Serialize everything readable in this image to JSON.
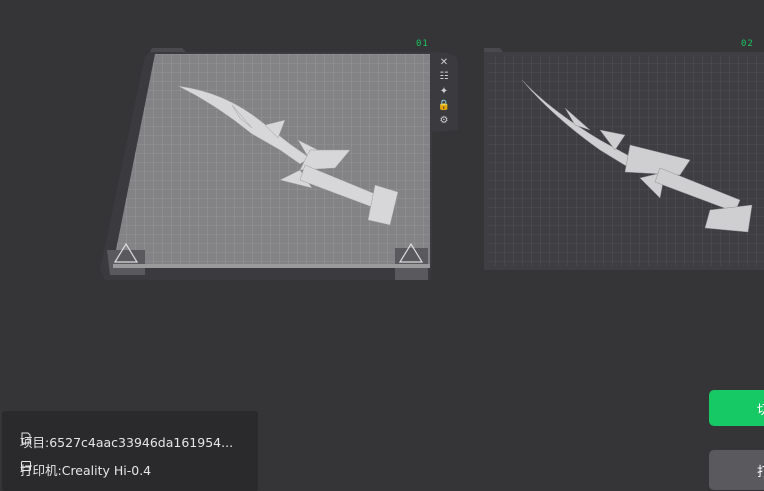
{
  "plates": [
    {
      "number": "01"
    },
    {
      "number": "02"
    }
  ],
  "plate_tools": [
    {
      "icon": "close-icon",
      "glyph": "✕"
    },
    {
      "icon": "list-icon",
      "glyph": "☷"
    },
    {
      "icon": "auto-arrange-icon",
      "glyph": "✦"
    },
    {
      "icon": "lock-icon",
      "glyph": "🔒"
    },
    {
      "icon": "settings-icon",
      "glyph": "⚙"
    }
  ],
  "info": {
    "project_label": "项目:6527c4aac33946da161954...",
    "printer_label": "打印机:Creality Hi-0.4"
  },
  "buttons": {
    "slice_label": "切",
    "print_label": "打"
  },
  "colors": {
    "background": "#353538",
    "accent_green": "#17c964",
    "plate_grid": "#8a8a8d"
  }
}
